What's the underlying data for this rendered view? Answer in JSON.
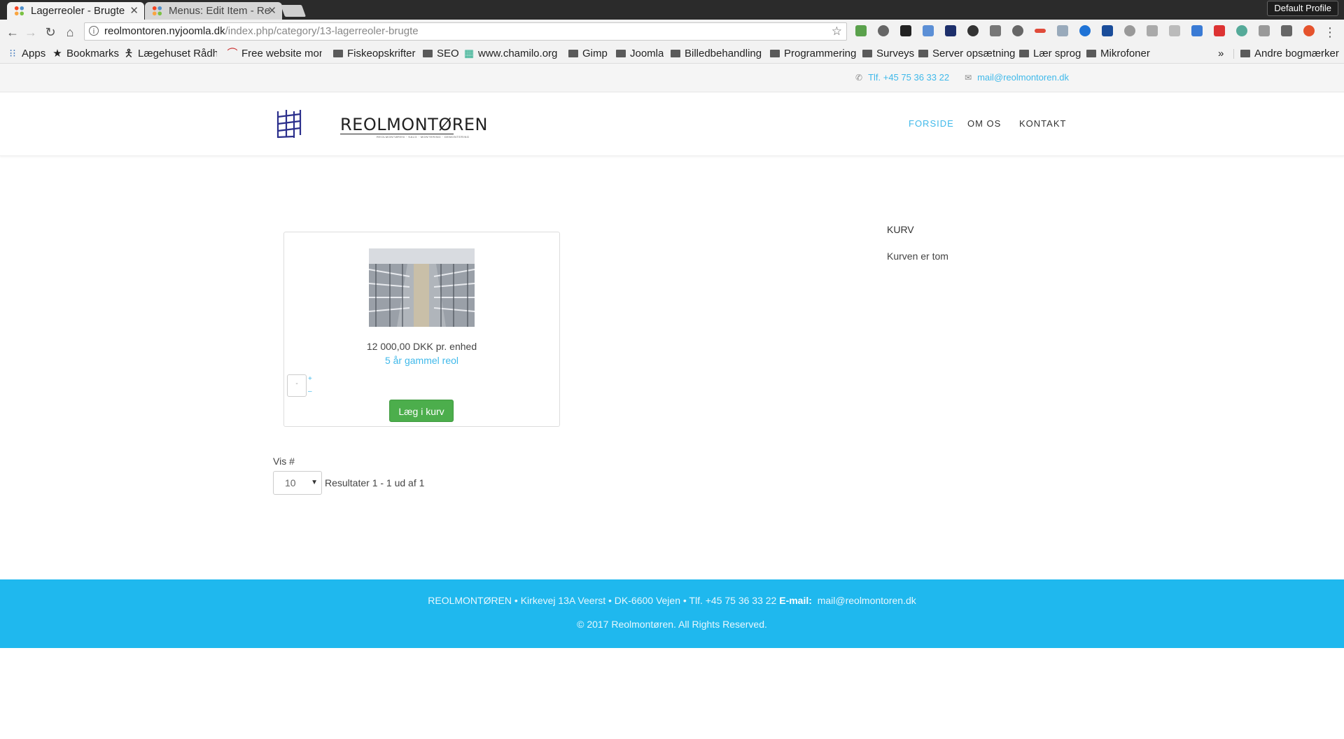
{
  "browser": {
    "tabs": [
      {
        "title": "Lagerreoler - Brugte",
        "active": true
      },
      {
        "title": "Menus: Edit Item - Re",
        "active": false
      }
    ],
    "profile": "Default Profile",
    "url_host": "reolmontoren.nyjoomla.dk",
    "url_path": "/index.php/category/13-lagerreoler-brugte",
    "bookmarks": [
      "Apps",
      "Bookmarks",
      "Lægehuset Rådhu",
      "Free website mon",
      "Fiskeopskrifter",
      "SEO",
      "www.chamilo.org",
      "Gimp",
      "Joomla",
      "Billedbehandling",
      "Programmering",
      "Surveys",
      "Server opsætning",
      "Lær sprog",
      "Mikrofoner"
    ],
    "bookmarks_overflow": "»",
    "other_bookmarks": "Andre bogmærker",
    "colors": {
      "chrome_dark": "#2b2b2b",
      "chrome_light": "#f2f2f2"
    }
  },
  "site": {
    "topbar": {
      "phone": "Tlf. +45 75 36 33 22",
      "email": "mail@reolmontoren.dk"
    },
    "logo": {
      "name": "REOLMONTØREN",
      "tagline": "REOLMONTØREN · SALG · MONTERING · DEMONTERING"
    },
    "menu": [
      {
        "label": "FORSIDE",
        "active": true
      },
      {
        "label": "OM OS",
        "active": false
      },
      {
        "label": "KONTAKT",
        "active": false
      }
    ],
    "product": {
      "price": "12 000,00 DKK pr. enhed",
      "description": "5 år gammel reol",
      "qty_placeholder": "-",
      "plus": "+",
      "minus": "–",
      "add_to_cart": "Læg i kurv"
    },
    "pagination": {
      "label": "Vis #",
      "selected": "10",
      "results": "Resultater 1 - 1 ud af 1"
    },
    "cart": {
      "title": "KURV",
      "empty_text": "Kurven er tom"
    },
    "footer": {
      "address": "REOLMONTØREN • Kirkevej 13A Veerst • DK-6600 Vejen • Tlf. +45 75 36 33 22",
      "email_label": "E-mail:",
      "email": "mail@reolmontoren.dk",
      "copyright": "© 2017 Reolmontøren. All Rights Reserved."
    },
    "colors": {
      "accent": "#40b9ea",
      "footer_bg": "#1fb8ee",
      "button_green": "#4cae4c"
    }
  }
}
